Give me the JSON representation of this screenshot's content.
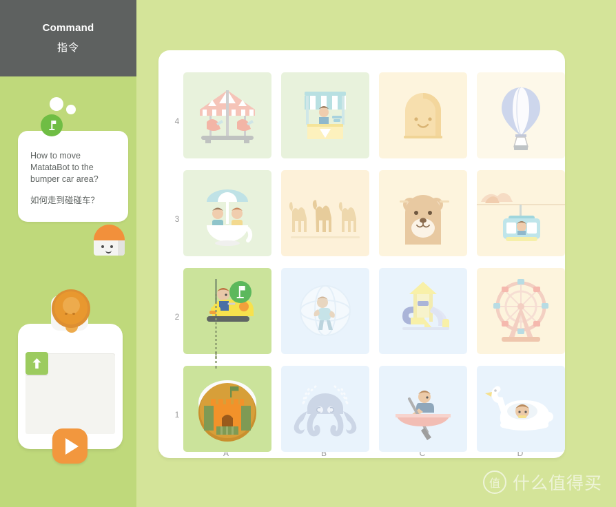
{
  "sidebar": {
    "header": {
      "title_en": "Command",
      "title_zh": "指令"
    },
    "bubble": {
      "question_en": "How to move MatataBot to the bumper car area?",
      "question_zh": "如何走到碰碰车？",
      "badge_icon": "flag-icon"
    },
    "command_card": {
      "blocks": [
        {
          "icon": "arrow-up-icon",
          "label": "move-forward",
          "color": "#9ccb5f"
        }
      ],
      "robot_icon": "matatabot-top-view",
      "play_icon": "play-icon"
    }
  },
  "map": {
    "row_labels": [
      "4",
      "3",
      "2",
      "1"
    ],
    "col_labels": [
      "A",
      "B",
      "C",
      "D"
    ],
    "robot_marker": {
      "cell": "A1",
      "icon": "matatabot-icon"
    },
    "goal_marker": {
      "cell": "A2",
      "icon": "flag-icon"
    },
    "path": {
      "from": "A1",
      "to": "A2",
      "style": "dotted"
    },
    "cells": [
      {
        "id": "A4",
        "row": "4",
        "col": "A",
        "name": "carousel",
        "bg": "#e8f2dc",
        "highlight": false
      },
      {
        "id": "B4",
        "row": "4",
        "col": "B",
        "name": "ice-cream-stand",
        "bg": "#e8f2dc",
        "highlight": false
      },
      {
        "id": "C4",
        "row": "4",
        "col": "C",
        "name": "fun-house",
        "bg": "#fdf4dd",
        "highlight": false
      },
      {
        "id": "D4",
        "row": "4",
        "col": "D",
        "name": "hot-air-balloon",
        "bg": "#fdf8e9",
        "highlight": false
      },
      {
        "id": "A3",
        "row": "3",
        "col": "A",
        "name": "teacup-ride",
        "bg": "#e8f2dc",
        "highlight": false
      },
      {
        "id": "B3",
        "row": "3",
        "col": "B",
        "name": "camel-ride",
        "bg": "#fdf1d9",
        "highlight": false
      },
      {
        "id": "C3",
        "row": "3",
        "col": "C",
        "name": "bear-mascot",
        "bg": "#fdf4dd",
        "highlight": false
      },
      {
        "id": "D3",
        "row": "3",
        "col": "D",
        "name": "cable-car",
        "bg": "#fdf4dd",
        "highlight": false
      },
      {
        "id": "A2",
        "row": "2",
        "col": "A",
        "name": "bumper-car",
        "bg": "#cbe39b",
        "highlight": true
      },
      {
        "id": "B2",
        "row": "2",
        "col": "B",
        "name": "zorb-ball",
        "bg": "#e9f3fc",
        "highlight": false
      },
      {
        "id": "C2",
        "row": "2",
        "col": "C",
        "name": "playground-slide",
        "bg": "#e9f3fc",
        "highlight": false
      },
      {
        "id": "D2",
        "row": "2",
        "col": "D",
        "name": "ferris-wheel",
        "bg": "#fdf4dd",
        "highlight": false
      },
      {
        "id": "A1",
        "row": "1",
        "col": "A",
        "name": "sandcastle",
        "bg": "#cbe39b",
        "highlight": true
      },
      {
        "id": "B1",
        "row": "1",
        "col": "B",
        "name": "octopus-ride",
        "bg": "#e9f3fc",
        "highlight": false
      },
      {
        "id": "C1",
        "row": "1",
        "col": "C",
        "name": "rowing-boat",
        "bg": "#e9f3fc",
        "highlight": false
      },
      {
        "id": "D1",
        "row": "1",
        "col": "D",
        "name": "swan-boat",
        "bg": "#e9f3fc",
        "highlight": false
      }
    ]
  },
  "watermark": {
    "logo_char": "值",
    "text": "什么值得买"
  },
  "colors": {
    "background": "#d4e499",
    "sidebar": "#bfd97b",
    "header": "#5e6160",
    "accent_green": "#6fbd44",
    "accent_orange": "#f2973e",
    "block_green": "#9ccb5f"
  }
}
